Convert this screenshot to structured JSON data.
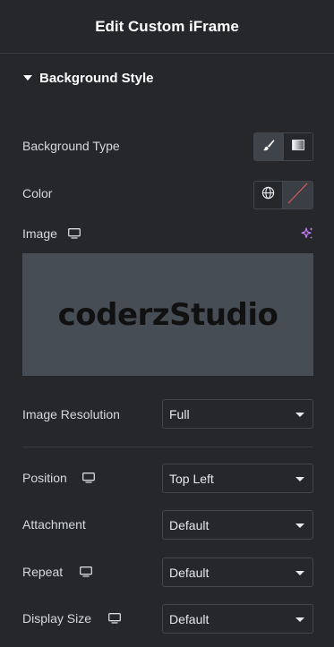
{
  "header": {
    "title": "Edit Custom iFrame"
  },
  "section": {
    "title": "Background Style"
  },
  "background_type": {
    "label": "Background Type"
  },
  "color": {
    "label": "Color"
  },
  "image": {
    "label": "Image",
    "logo_text": "coderzStudio"
  },
  "image_resolution": {
    "label": "Image Resolution",
    "value": "Full"
  },
  "position": {
    "label": "Position",
    "value": "Top Left"
  },
  "attachment": {
    "label": "Attachment",
    "value": "Default"
  },
  "repeat": {
    "label": "Repeat",
    "value": "Default"
  },
  "display_size": {
    "label": "Display Size",
    "value": "Default"
  },
  "colors": {
    "background": "#26272b",
    "active_segment": "#3f444b",
    "sparkle": "#c77dff",
    "clear_slash": "#e05a5a"
  }
}
